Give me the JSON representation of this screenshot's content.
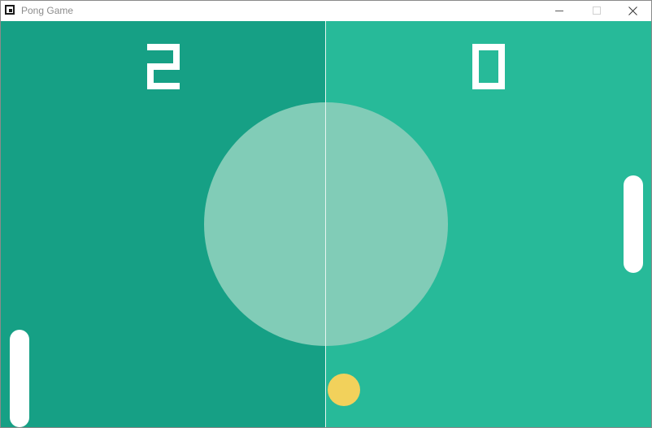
{
  "window": {
    "title": "Pong Game",
    "icons": {
      "app": "app-icon",
      "minimize": "minimize-icon",
      "maximize": "maximize-icon",
      "close": "close-icon"
    }
  },
  "game": {
    "score": {
      "left": "2",
      "right": "0"
    },
    "colors": {
      "left_half": "#16a085",
      "right_half": "#27ba99",
      "center_circle": "#81ccb7",
      "center_line": "#e6f5f0",
      "paddle": "#ffffff",
      "score": "#ffffff",
      "ball": "#f2d15b"
    }
  }
}
